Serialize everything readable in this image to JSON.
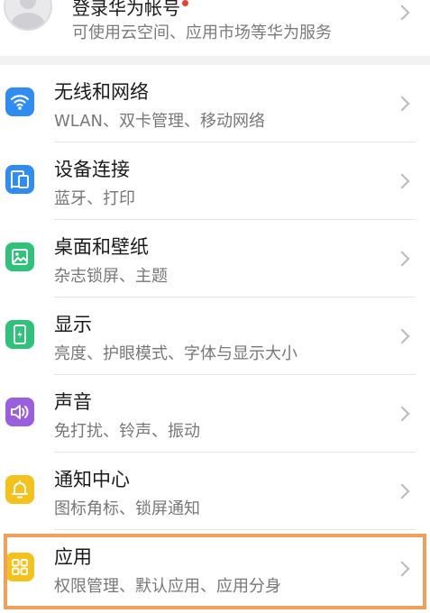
{
  "account": {
    "title": "登录华为帐号",
    "subtitle": "可使用云空间、应用市场等华为服务"
  },
  "items": [
    {
      "title": "无线和网络",
      "subtitle": "WLAN、双卡管理、移动网络",
      "icon": "wifi-icon",
      "color": "#2f8cf0"
    },
    {
      "title": "设备连接",
      "subtitle": "蓝牙、打印",
      "icon": "device-connection-icon",
      "color": "#2f8cf0"
    },
    {
      "title": "桌面和壁纸",
      "subtitle": "杂志锁屏、主题",
      "icon": "wallpaper-icon",
      "color": "#2ec27a"
    },
    {
      "title": "显示",
      "subtitle": "亮度、护眼模式、字体与显示大小",
      "icon": "display-icon",
      "color": "#2ec27a"
    },
    {
      "title": "声音",
      "subtitle": "免打扰、铃声、振动",
      "icon": "sound-icon",
      "color": "#9a5fe0"
    },
    {
      "title": "通知中心",
      "subtitle": "图标角标、锁屏通知",
      "icon": "notification-bell-icon",
      "color": "#f5c21b"
    },
    {
      "title": "应用",
      "subtitle": "权限管理、默认应用、应用分身",
      "icon": "apps-icon",
      "color": "#f5c21b"
    }
  ],
  "highlight_color": "#f1a05c"
}
